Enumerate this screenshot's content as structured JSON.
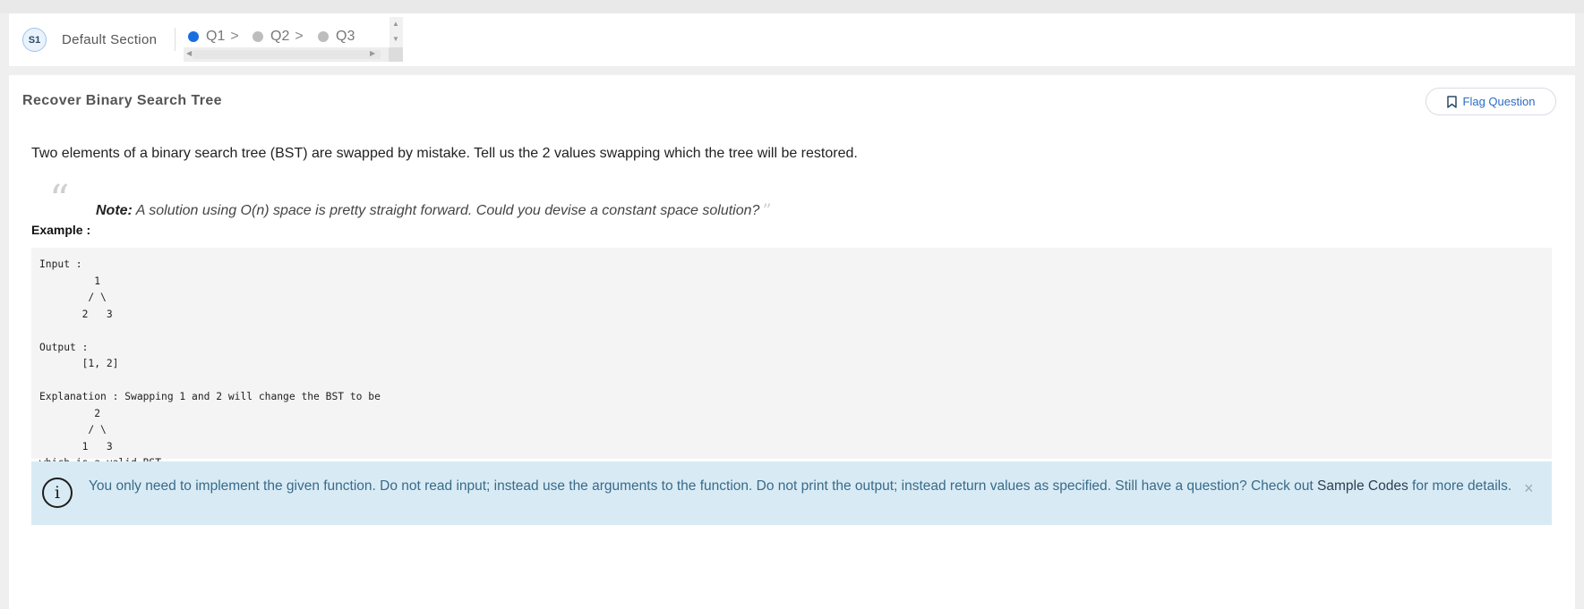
{
  "section": {
    "badge": "S1",
    "name": "Default Section",
    "questions": [
      {
        "label": "Q1",
        "active": true
      },
      {
        "label": "Q2",
        "active": false
      },
      {
        "label": "Q3",
        "active": false
      }
    ],
    "chevron": ">"
  },
  "question": {
    "title": "Recover Binary Search Tree",
    "flag_label": "Flag Question",
    "description": "Two elements of a binary search tree (BST) are swapped by mistake. Tell us the 2 values swapping which the tree will be restored.",
    "note_label": "Note:",
    "note_text": " A solution using O(n) space is pretty straight forward. Could you devise a constant space solution?",
    "example_label": "Example :",
    "example_code": "Input : \n         1\n        / \\\n       2   3\n\nOutput : \n       [1, 2]\n\nExplanation : Swapping 1 and 2 will change the BST to be \n         2\n        / \\\n       1   3\nwhich is a valid BST"
  },
  "info": {
    "text_before": "You only need to implement the given function. Do not read input; instead use the arguments to the function. Do not print the output; instead return values as specified. Still have a question? Check out ",
    "link_text": "Sample Codes",
    "text_after": " for more details.",
    "close": "×"
  },
  "colors": {
    "accent": "#1a6fe0",
    "info_bg": "#d8ebf5",
    "info_text": "#3a6a89",
    "flag_text": "#2b6cc4"
  },
  "icons": {
    "info": "info-circle-icon",
    "flag": "bookmark-icon",
    "close": "close-icon"
  }
}
